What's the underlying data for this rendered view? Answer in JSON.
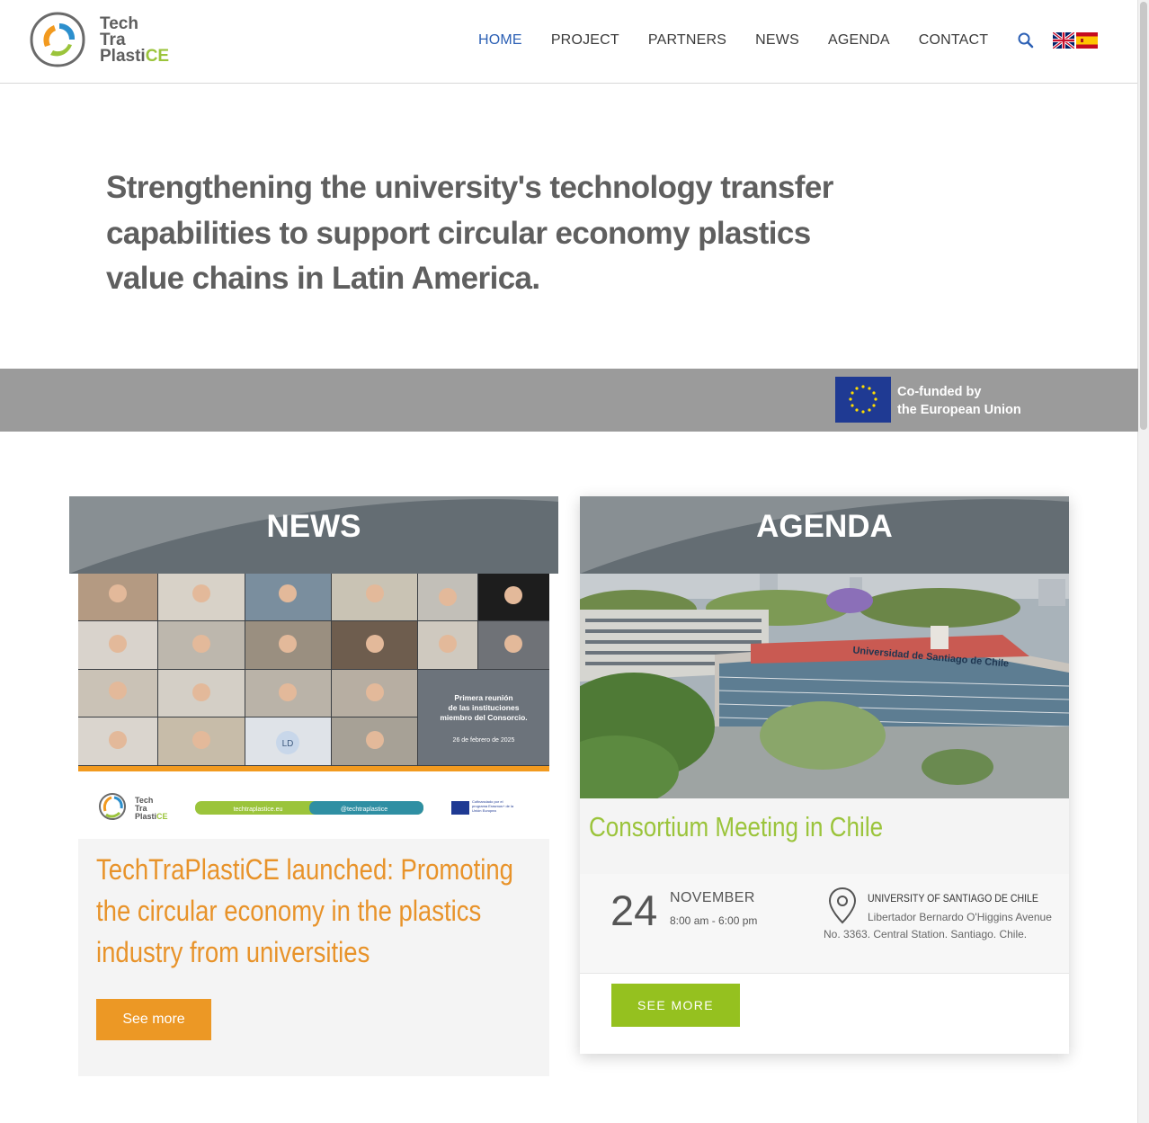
{
  "header": {
    "logo": {
      "line1": "Tech",
      "line2": "Tra",
      "line3_a": "Plasti",
      "line3_b": "CE"
    },
    "nav": [
      "HOME",
      "PROJECT",
      "PARTNERS",
      "NEWS",
      "AGENDA",
      "CONTACT"
    ],
    "active_nav": "HOME",
    "search_icon": "search-icon",
    "languages": [
      "English",
      "Español"
    ]
  },
  "hero": {
    "text": "Strengthening the university's technology transfer capabilities to support circular economy plastics value chains in Latin America."
  },
  "eu_band": {
    "line1": "Co-funded by",
    "line2": "the European Union"
  },
  "news": {
    "heading": "NEWS",
    "image_caption": {
      "line1": "Primera reunión",
      "line2": "de las instituciones",
      "line3": "miembro del Consorcio.",
      "date": "26 de febrero de 2025",
      "initials": "LD",
      "url": "techtraplastice.eu",
      "handle": "@techtraplastice",
      "eu_small": "Cofinanciado por el programa Erasmus+ de la Unión Europea"
    },
    "title": "TechTraPlastiCE launched: Promoting the circular economy in the plastics industry from universities",
    "button": "See more"
  },
  "agenda": {
    "heading": "AGENDA",
    "image_sign": "Universidad de Santiago de Chile",
    "title": "Consortium Meeting in Chile",
    "day": "24",
    "month": "NOVEMBER",
    "time": "8:00 am - 6:00 pm",
    "venue": "UNIVERSITY OF SANTIAGO DE CHILE",
    "address": "Libertador Bernardo O'Higgins Avenue No. 3363. Central Station. Santiago. Chile.",
    "button": "SEE MORE"
  },
  "colors": {
    "accent_blue": "#2b5fb4",
    "news_orange": "#e8932a",
    "agenda_green": "#9bc43b",
    "section_gray": "#646d73"
  }
}
